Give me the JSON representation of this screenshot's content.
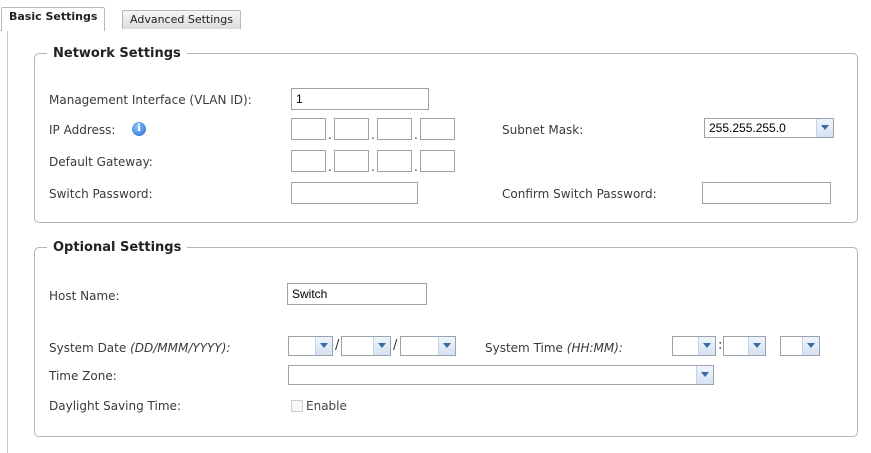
{
  "tabs": [
    {
      "label": "Basic Settings",
      "active": true
    },
    {
      "label": "Advanced Settings",
      "active": false
    }
  ],
  "network": {
    "legend": "Network Settings",
    "mgmt_label": "Management Interface (VLAN ID):",
    "mgmt_value": "1",
    "ip_label": "IP Address:",
    "ip_octets": [
      "",
      "",
      "",
      ""
    ],
    "subnet_label": "Subnet Mask:",
    "subnet_value": "255.255.255.0",
    "gateway_label": "Default Gateway:",
    "gateway_octets": [
      "",
      "",
      "",
      ""
    ],
    "password_label": "Switch Password:",
    "confirm_label": "Confirm Switch Password:",
    "separator": "."
  },
  "optional": {
    "legend": "Optional Settings",
    "host_label": "Host Name:",
    "host_value": "Switch",
    "date_label": "System Date",
    "date_format": "(DD/MMM/YYYY):",
    "date_separator": "/",
    "time_label": "System Time",
    "time_format": "(HH:MM):",
    "time_separator": ":",
    "timezone_label": "Time Zone:",
    "dst_label": "Daylight Saving Time:",
    "dst_enable": "Enable"
  },
  "icons": {
    "info": "info-icon",
    "dropdown": "chevron-down-icon",
    "info_glyph": "i"
  },
  "colors": {
    "border": "#b5b5b5",
    "dropdown_arrow": "#3c6aa6",
    "info_icon": "#1e6ad1"
  }
}
